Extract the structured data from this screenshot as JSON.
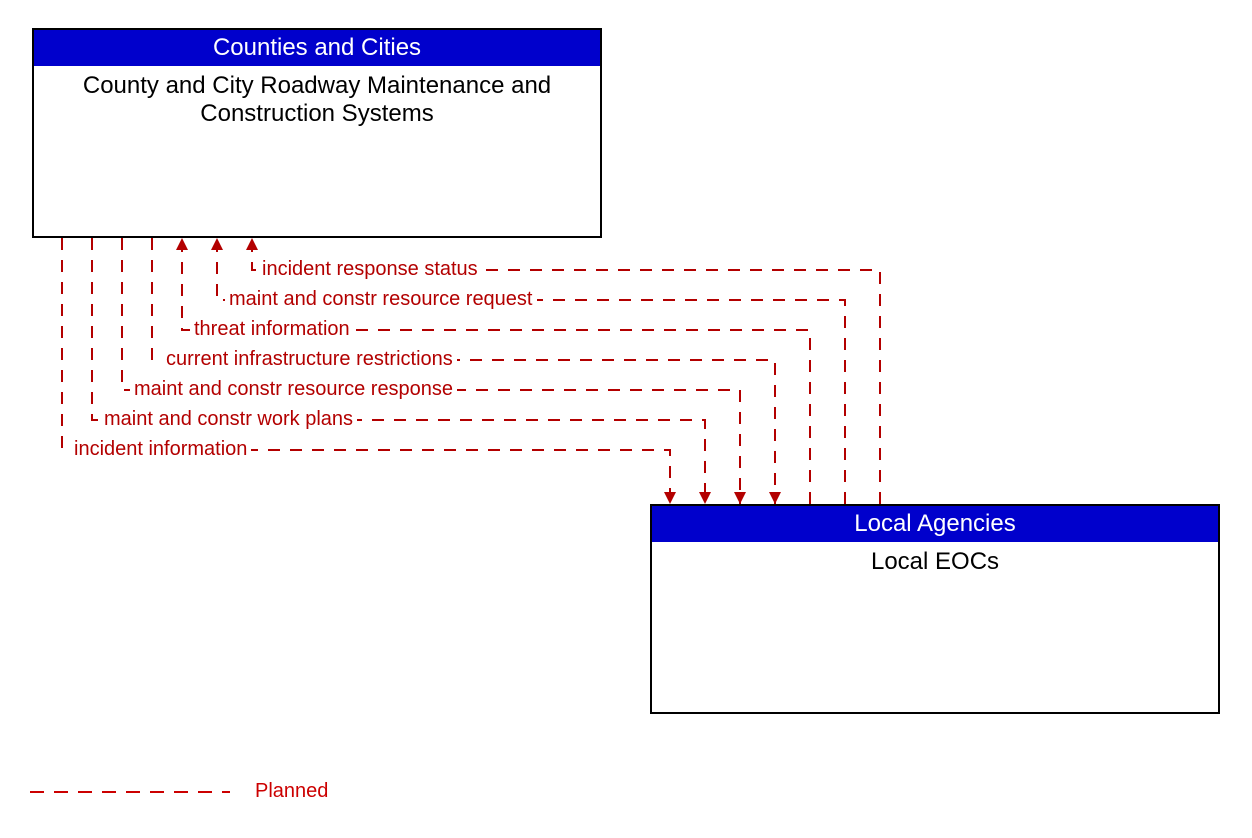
{
  "entities": {
    "top": {
      "header": "Counties and Cities",
      "body": "County and City Roadway Maintenance and Construction Systems"
    },
    "bottom": {
      "header": "Local Agencies",
      "body": "Local EOCs"
    }
  },
  "flows": {
    "f1": "incident response status",
    "f2": "maint and constr resource request",
    "f3": "threat information",
    "f4": "current infrastructure restrictions",
    "f5": "maint and constr resource response",
    "f6": "maint and constr work plans",
    "f7": "incident information"
  },
  "legend": {
    "planned": "Planned"
  },
  "colors": {
    "header_bg": "#0000cc",
    "flow": "#b30000"
  }
}
